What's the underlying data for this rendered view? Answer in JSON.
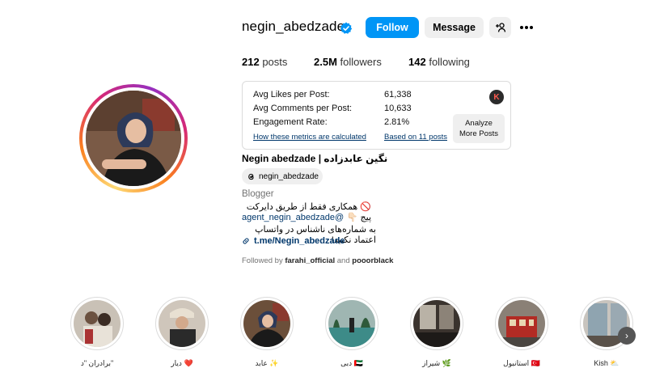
{
  "profile": {
    "username": "negin_abedzade",
    "follow_label": "Follow",
    "message_label": "Message",
    "posts_count": "212",
    "posts_label": "posts",
    "followers_count": "2.5M",
    "followers_label": "followers",
    "following_count": "142",
    "following_label": "following",
    "full_name": "Negin abedzade | نگین عابدزاده",
    "threads_handle": "negin_abedzade",
    "category": "Blogger",
    "bio_line1": "🚫 همکاری فقط از طریق دایرکت پیج 👇🏻",
    "bio_mention": "agent_negin_abedzade@",
    "bio_line3": "به شماره‌های ناشناس در واتساپ اعتماد نکنید!",
    "bio_link": "t.me/Negin_abedzade",
    "followed_by_prefix": "Followed by",
    "followed_by_user1": "farahi_official",
    "followed_by_and": "and",
    "followed_by_user2": "pooorblack"
  },
  "metrics": {
    "avg_likes_label": "Avg Likes per Post:",
    "avg_likes_value": "61,338",
    "avg_comments_label": "Avg Comments per Post:",
    "avg_comments_value": "10,633",
    "engagement_label": "Engagement Rate:",
    "engagement_value": "2.81%",
    "how_link": "How these metrics are calculated",
    "based_link": "Based on 11 posts",
    "analyze_line1": "Analyze",
    "analyze_line2": "More Posts",
    "logo_letter": "K"
  },
  "highlights": [
    {
      "label": "برادران \"د\""
    },
    {
      "label": "دیار ❤️"
    },
    {
      "label": "عابد ✨"
    },
    {
      "label": "دبی 🇦🇪"
    },
    {
      "label": "شیراز 🌿"
    },
    {
      "label": "استانبول 🇹🇷"
    },
    {
      "label": "Kish ⛅"
    }
  ],
  "colors": {
    "accent": "#0095f6",
    "link": "#00376b",
    "verified": "#0095f6"
  },
  "icons": {
    "verified": "verified-badge-icon",
    "add_user": "add-user-icon",
    "more": "more-options-icon",
    "threads": "threads-icon",
    "link": "link-icon",
    "next": "chevron-right-icon"
  }
}
